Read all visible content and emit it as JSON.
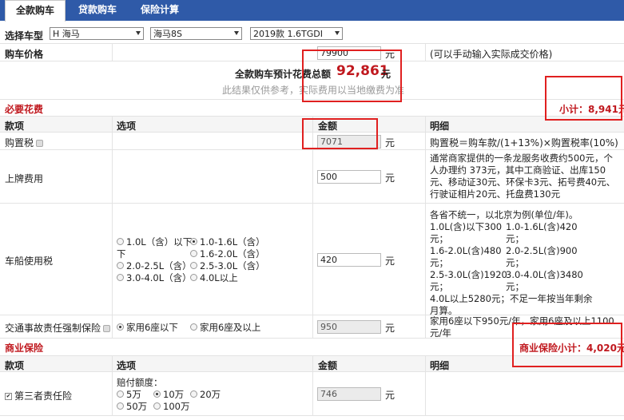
{
  "tabs": [
    {
      "label": "全款购车",
      "active": true
    },
    {
      "label": "贷款购车",
      "active": false
    },
    {
      "label": "保险计算",
      "active": false
    }
  ],
  "select_model": {
    "label": "选择车型",
    "brand": "H 海马",
    "series": "海马8S",
    "spec": "2019款 1.6TGDI"
  },
  "price": {
    "label": "购车价格",
    "value": "79900",
    "unit": "元",
    "hint": "(可以手动输入实际成交价格)"
  },
  "total": {
    "label": "全款购车预计花费总额",
    "value": "92,861",
    "unit": "元",
    "note": "此结果仅供参考，实际费用以当地缴费为准"
  },
  "required": {
    "title": "必要花费",
    "subtotal": "小计：8,941元",
    "headers": [
      "款项",
      "选项",
      "金额",
      "明细"
    ],
    "purchase_tax": {
      "label": "购置税",
      "value": "7071",
      "unit": "元",
      "detail": "购置税＝购车款/(1+13%)×购置税率(10%)"
    },
    "license": {
      "label": "上牌费用",
      "value": "500",
      "unit": "元",
      "detail": [
        "通常商家提供的一条龙服务收费约500元，个",
        "人办理约 373元，其中工商验证、出库150",
        "元、移动证30元、环保卡3元、拓号费40元、",
        "行驶证相片20元、托盘费130元"
      ]
    },
    "vessel_tax": {
      "label": "车船使用税",
      "options": [
        {
          "text": "1.0L（含）以下",
          "checked": false
        },
        {
          "text": "1.0-1.6L（含）",
          "checked": true
        },
        {
          "text": "1.6-2.0L（含）",
          "checked": false
        },
        {
          "text": "2.0-2.5L（含）",
          "checked": false
        },
        {
          "text": "2.5-3.0L（含）",
          "checked": false
        },
        {
          "text": "3.0-4.0L（含）",
          "checked": false
        },
        {
          "text": "4.0L以上",
          "checked": false
        }
      ],
      "value": "420",
      "unit": "元",
      "detail_title": "各省不统一，以北京为例(单位/年)。",
      "detail": [
        [
          "1.0L(含)以下300",
          "1.0-1.6L(含)420"
        ],
        [
          "元；",
          "元；"
        ],
        [
          "1.6-2.0L(含)480",
          "2.0-2.5L(含)900"
        ],
        [
          "元；",
          "元；"
        ],
        [
          "2.5-3.0L(含)1920",
          "3.0-4.0L(含)3480"
        ],
        [
          "元；",
          "元；"
        ]
      ],
      "detail_tail": [
        "4.0L以上5280元；不足一年按当年剩余",
        "月算。"
      ]
    },
    "compulsory": {
      "label": "交通事故责任强制保险",
      "options": [
        {
          "text": "家用6座以下",
          "checked": true
        },
        {
          "text": "家用6座及以上",
          "checked": false
        }
      ],
      "value": "950",
      "unit": "元",
      "detail": [
        "家用6座以下950元/年，家用6座及以上1100",
        "元/年"
      ]
    }
  },
  "commercial": {
    "title": "商业保险",
    "subtotal": "商业保险小计：4,020元",
    "headers": [
      "款项",
      "选项",
      "金额",
      "明细"
    ],
    "third_party": {
      "label": "第三者责任险",
      "checked": true,
      "sub_label": "赔付额度：",
      "options": [
        {
          "text": "5万",
          "checked": false
        },
        {
          "text": "10万",
          "checked": true
        },
        {
          "text": "20万",
          "checked": false
        },
        {
          "text": "50万",
          "checked": false
        },
        {
          "text": "100万",
          "checked": false
        }
      ],
      "value": "746",
      "unit": "元"
    }
  },
  "colors": {
    "tab_bar": "#2f5aa8",
    "accent_red": "#c0181e",
    "highlight_box": "#e02020"
  }
}
